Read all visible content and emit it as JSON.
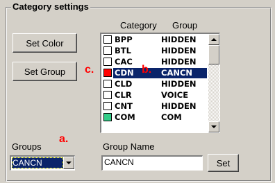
{
  "panel": {
    "title": "Category settings"
  },
  "buttons": {
    "set_color": "Set Color",
    "set_group": "Set Group",
    "set": "Set"
  },
  "list": {
    "headers": {
      "category": "Category",
      "group": "Group"
    },
    "rows": [
      {
        "category": "BPP",
        "group": "HIDDEN",
        "swatch": "#ffffff"
      },
      {
        "category": "BTL",
        "group": "HIDDEN",
        "swatch": "#ffffff"
      },
      {
        "category": "CAC",
        "group": "HIDDEN",
        "swatch": "#ffffff"
      },
      {
        "category": "CDN",
        "group": "CANCN",
        "swatch": "#ff0000",
        "selected": true
      },
      {
        "category": "CLD",
        "group": "HIDDEN",
        "swatch": "#ffffff"
      },
      {
        "category": "CLR",
        "group": "VOICE",
        "swatch": "#ffffff"
      },
      {
        "category": "CNT",
        "group": "HIDDEN",
        "swatch": "#ffffff"
      },
      {
        "category": "COM",
        "group": "COM",
        "swatch": "#33cc88"
      }
    ]
  },
  "groups": {
    "label": "Groups",
    "selected": "CANCN"
  },
  "group_name": {
    "label": "Group Name",
    "value": "CANCN"
  },
  "annotations": {
    "a": "a.",
    "b": "b.",
    "c": "c."
  },
  "colors": {
    "selection": "#0a246a",
    "annotation": "#ff0000",
    "face": "#d4d0c8"
  }
}
